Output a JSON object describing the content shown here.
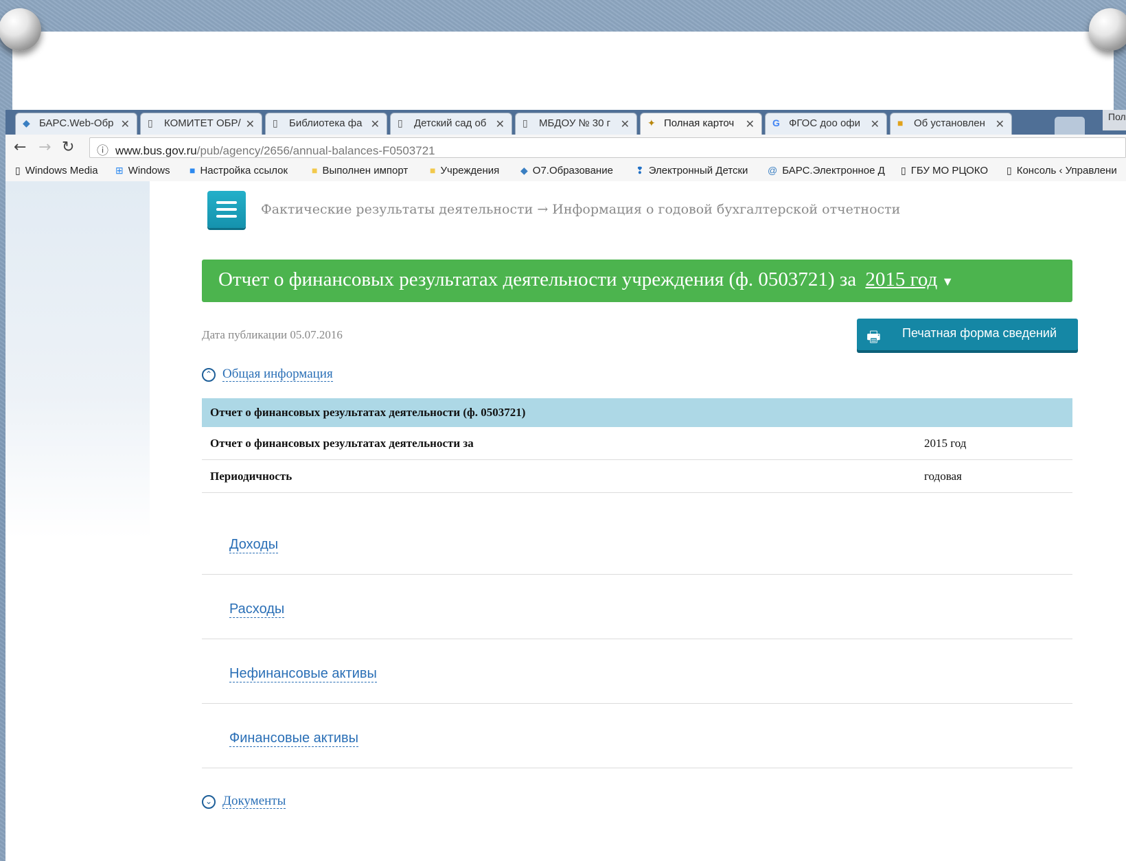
{
  "tabs": [
    {
      "label": "БАРС.Web-Обр",
      "icon": "bars-icon",
      "active": false
    },
    {
      "label": "КОМИТЕТ ОБР/",
      "icon": "page-icon",
      "active": false
    },
    {
      "label": "Библиотека фа",
      "icon": "page-icon",
      "active": false
    },
    {
      "label": "Детский сад об",
      "icon": "page-icon",
      "active": false
    },
    {
      "label": "МБДОУ № 30 г",
      "icon": "page-icon",
      "active": false
    },
    {
      "label": "Полная карточ",
      "icon": "emblem-icon",
      "active": true
    },
    {
      "label": "ФГОС доо офи",
      "icon": "google-icon",
      "active": false
    },
    {
      "label": "Об установлен",
      "icon": "folder-color-icon",
      "active": false
    }
  ],
  "profile_label": "Пол",
  "address": {
    "host": "www.bus.gov.ru",
    "path": "/pub/agency/2656/annual-balances-F0503721"
  },
  "bookmarks": [
    {
      "label": "Windows Media",
      "icon": "page-icon"
    },
    {
      "label": "Windows",
      "icon": "windows-icon"
    },
    {
      "label": "Настройка ссылок",
      "icon": "tiles-icon"
    },
    {
      "label": "Выполнен импорт",
      "icon": "folder-icon"
    },
    {
      "label": "Учреждения",
      "icon": "folder-icon"
    },
    {
      "label": "О7.Образование",
      "icon": "bars-icon"
    },
    {
      "label": "Электронный Детски",
      "icon": "pin-icon"
    },
    {
      "label": "БАРС.Электронное Д",
      "icon": "at-icon"
    },
    {
      "label": "ГБУ МО РЦОКО",
      "icon": "page-icon"
    },
    {
      "label": "Консоль ‹ Управлени",
      "icon": "page-icon"
    }
  ],
  "page": {
    "breadcrumb": "Фактические результаты деятельности → Информация о годовой бухгалтерской отчетности",
    "banner_title": "Отчет о финансовых результатах деятельности учреждения (ф. 0503721) за",
    "banner_year": "2015 год",
    "pub_date": "Дата публикации 05.07.2016",
    "print_button": "Печатная форма сведений",
    "general_info_toggle": "Общая информация",
    "table": {
      "header": "Отчет о финансовых результатах деятельности (ф. 0503721)",
      "rows": [
        {
          "label": "Отчет о финансовых результатах деятельности за",
          "value": "2015 год"
        },
        {
          "label": "Периодичность",
          "value": "годовая"
        }
      ]
    },
    "sections": [
      "Доходы",
      "Расходы",
      "Нефинансовые активы",
      "Финансовые активы"
    ],
    "documents_toggle": "Документы"
  },
  "colors": {
    "banner_green": "#4cb44e",
    "print_button_teal": "#1587a5",
    "table_header_blue": "#add8e6",
    "link_blue": "#2a6fb6"
  }
}
